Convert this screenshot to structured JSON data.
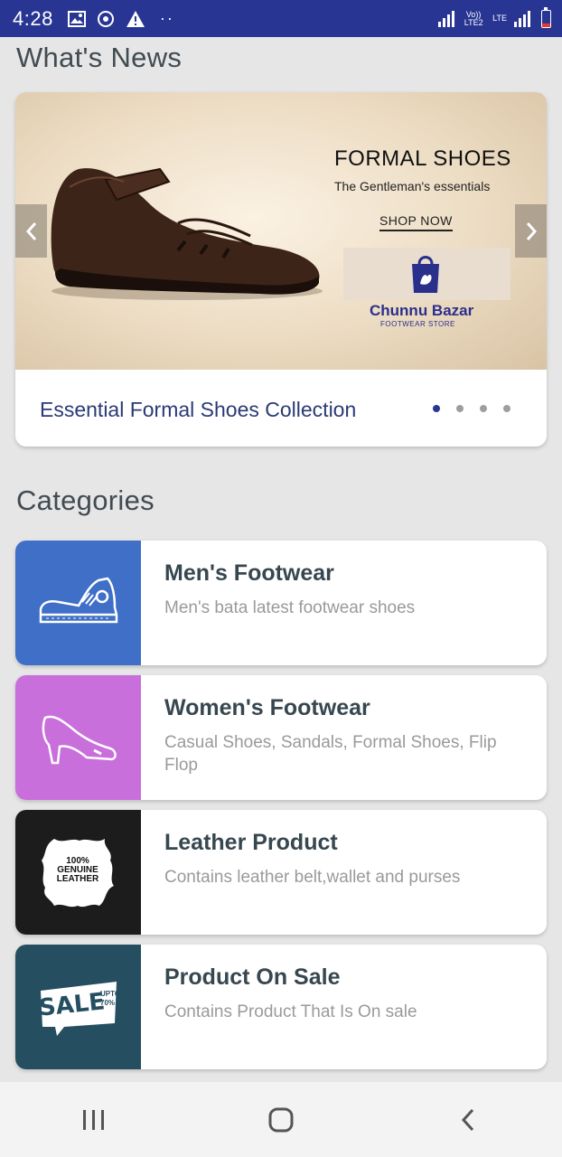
{
  "status_bar": {
    "time": "4:28",
    "network_left": "Vo)) LTE2",
    "network_right": "LTE",
    "roaming": "R"
  },
  "news": {
    "section_title": "What's News",
    "banner": {
      "headline": "FORMAL SHOES",
      "tagline": "The Gentleman's essentials",
      "cta": "SHOP NOW",
      "brand_name": "Chunnu Bazar",
      "brand_tagline": "FOOTWEAR STORE"
    },
    "caption": "Essential Formal Shoes Collection",
    "slide_count": 4,
    "active_slide": 1
  },
  "categories": {
    "section_title": "Categories",
    "items": [
      {
        "title": "Men's Footwear",
        "description": "Men's bata latest footwear shoes",
        "color": "#3f6fc6",
        "icon": "sneaker-icon"
      },
      {
        "title": "Women's Footwear",
        "description": "Casual Shoes, Sandals, Formal Shoes, Flip Flop",
        "color": "#c86fdc",
        "icon": "high-heel-icon"
      },
      {
        "title": "Leather Product",
        "description": "Contains leather belt,wallet and purses",
        "color": "#1c1c1c",
        "icon": "leather-hide-icon",
        "badge_text": "100% GENUINE LEATHER"
      },
      {
        "title": "Product On Sale",
        "description": "Contains Product That Is On sale",
        "color": "#254f61",
        "icon": "sale-tag-icon",
        "badge_text": "SALE",
        "badge_sub": "UPTO 70%"
      }
    ]
  },
  "colors": {
    "status_bar": "#283593",
    "background": "#e6e6e6",
    "active_dot": "#283593"
  }
}
